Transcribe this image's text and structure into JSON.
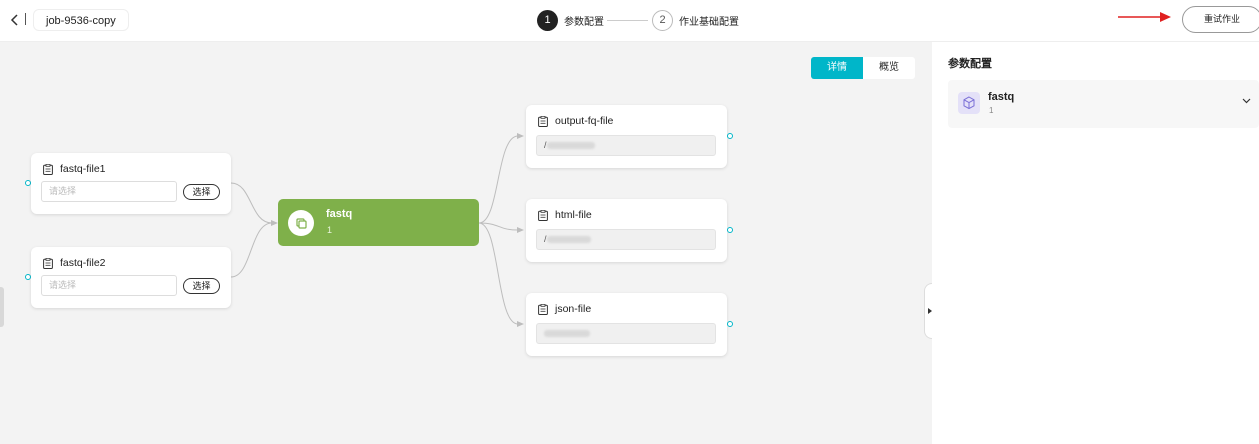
{
  "header": {
    "job_name": "job-9536-copy",
    "steps": [
      {
        "number": "1",
        "label": "参数配置"
      },
      {
        "number": "2",
        "label": "作业基础配置"
      }
    ],
    "retry_label": "重试作业"
  },
  "canvas": {
    "view_toggle": {
      "detail": "详情",
      "overview": "概览",
      "active": "详情"
    },
    "inputs": [
      {
        "title": "fastq-file1",
        "placeholder": "请选择",
        "select_label": "选择"
      },
      {
        "title": "fastq-file2",
        "placeholder": "请选择",
        "select_label": "选择"
      }
    ],
    "process": {
      "title": "fastq",
      "subtitle": "1"
    },
    "outputs": [
      {
        "title": "output-fq-file",
        "value_prefix": "/"
      },
      {
        "title": "html-file",
        "value_prefix": "/"
      },
      {
        "title": "json-file",
        "value_prefix": ""
      }
    ]
  },
  "panel": {
    "title": "参数配置",
    "card": {
      "title": "fastq",
      "subtitle": "1"
    }
  },
  "colors": {
    "accent": "#00b6c9",
    "process_node": "#7fb04a",
    "step_active": "#222222",
    "arrow": "#e02020"
  },
  "icons": [
    "chevron-left-icon",
    "document-icon",
    "copy-icon",
    "cube-icon",
    "chevron-down-icon",
    "arrow-right-icon"
  ]
}
